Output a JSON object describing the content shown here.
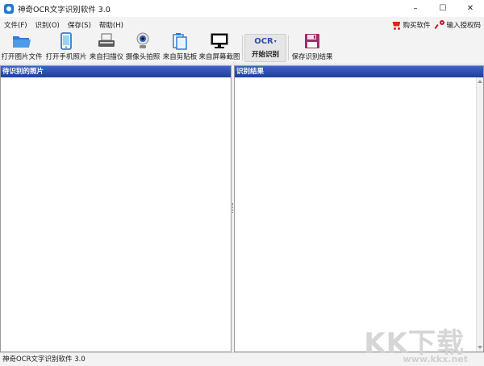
{
  "window": {
    "title": "神奇OCR文字识别软件 3.0",
    "controls": {
      "minimize": "–",
      "maximize": "☐",
      "close": "✕"
    }
  },
  "menu": {
    "items": [
      {
        "label": "文件(F)"
      },
      {
        "label": "识别(O)"
      },
      {
        "label": "保存(S)"
      },
      {
        "label": "帮助(H)"
      }
    ],
    "buy": {
      "label": "购买软件",
      "icon": "cart-icon",
      "color": "#d9261c"
    },
    "license": {
      "label": "输入授权码",
      "icon": "key-icon",
      "color": "#c8161d"
    }
  },
  "toolbar": {
    "open_image": {
      "label": "打开图片文件",
      "icon": "folder-icon"
    },
    "phone_photo": {
      "label": "打开手机照片",
      "icon": "phone-icon"
    },
    "scanner": {
      "label": "来自扫描仪",
      "icon": "scanner-icon"
    },
    "camera": {
      "label": "摄像头拍照",
      "icon": "webcam-icon"
    },
    "clipboard": {
      "label": "来自剪贴板",
      "icon": "clipboard-icon"
    },
    "screenshot": {
      "label": "来自屏幕截图",
      "icon": "monitor-icon"
    },
    "ocr": {
      "icon_text": "OCR",
      "label": "开始识别"
    },
    "save_result": {
      "label": "保存识别结果",
      "icon": "floppy-icon"
    }
  },
  "panels": {
    "left_title": "待识别的照片",
    "right_title": "识别结果"
  },
  "status": {
    "text": "神奇OCR文字识别软件 3.0"
  },
  "watermark": {
    "big": "KK下载",
    "url": "www.kkx.net"
  },
  "colors": {
    "panel_header": "#2a4fb0",
    "accent_blue": "#1f7ad1"
  }
}
